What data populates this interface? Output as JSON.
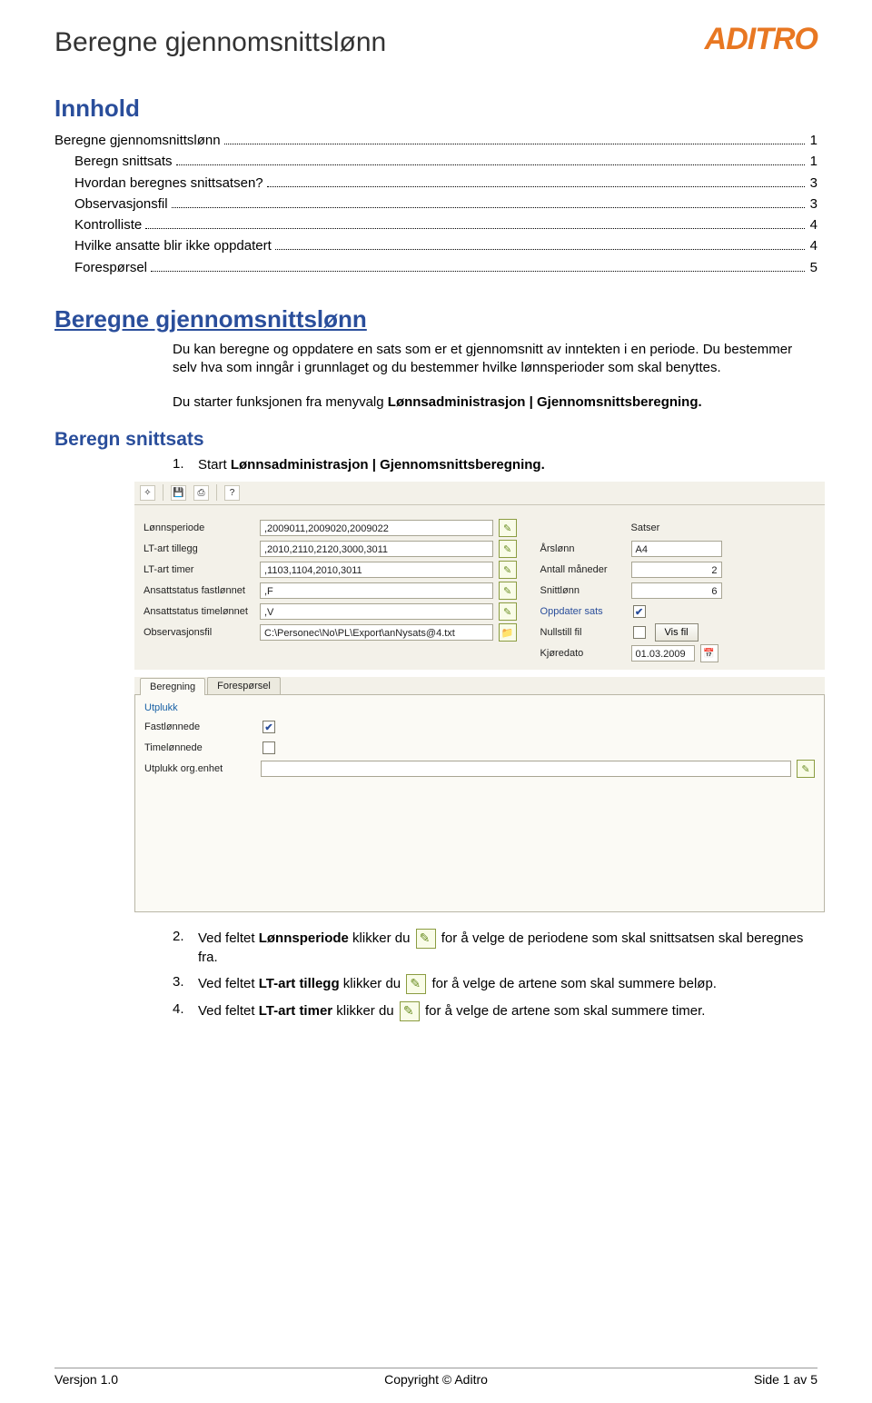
{
  "header": {
    "title": "Beregne gjennomsnittslønn",
    "logo": "ADITRO"
  },
  "toc": {
    "heading": "Innhold",
    "items": [
      {
        "label": "Beregne gjennomsnittslønn",
        "page": "1",
        "indent": false
      },
      {
        "label": "Beregn snittsats",
        "page": "1",
        "indent": true
      },
      {
        "label": "Hvordan beregnes snittsatsen?",
        "page": "3",
        "indent": true
      },
      {
        "label": "Observasjonsfil",
        "page": "3",
        "indent": true
      },
      {
        "label": "Kontrolliste",
        "page": "4",
        "indent": true
      },
      {
        "label": "Hvilke ansatte blir ikke oppdatert",
        "page": "4",
        "indent": true
      },
      {
        "label": "Forespørsel",
        "page": "5",
        "indent": true
      }
    ]
  },
  "main_heading": "Beregne gjennomsnittslønn",
  "para1": "Du kan beregne og oppdatere en sats som er et gjennomsnitt av inntekten i en periode. Du bestemmer selv hva som inngår i grunnlaget og du bestemmer hvilke lønnsperioder som skal benyttes.",
  "para2_a": "Du starter funksjonen fra menyvalg ",
  "para2_b": "Lønnsadministrasjon | Gjennomsnittsberegning.",
  "sub_heading": "Beregn snittsats",
  "step1_a": "Start ",
  "step1_b": "Lønnsadministrasjon | Gjennomsnittsberegning.",
  "step2_a": "Ved feltet ",
  "step2_b": "Lønnsperiode",
  "step2_c": " klikker du ",
  "step2_d": " for å velge de periodene som skal snittsatsen skal beregnes fra.",
  "step3_a": "Ved feltet ",
  "step3_b": "LT-art tillegg",
  "step3_c": " klikker du ",
  "step3_d": " for å velge de artene som skal summere beløp.",
  "step4_a": "Ved feltet ",
  "step4_b": "LT-art timer",
  "step4_c": " klikker du ",
  "step4_d": " for å velge de artene som skal summere timer.",
  "app": {
    "left": {
      "lonnsperiode": {
        "label": "Lønnsperiode",
        "value": ",2009011,2009020,2009022"
      },
      "lt_tillegg": {
        "label": "LT-art tillegg",
        "value": ",2010,2110,2120,3000,3011"
      },
      "lt_timer": {
        "label": "LT-art timer",
        "value": ",1103,1104,2010,3011"
      },
      "fastlonnet": {
        "label": "Ansattstatus fastlønnet",
        "value": ",F"
      },
      "timelonnet": {
        "label": "Ansattstatus timelønnet",
        "value": ",V"
      },
      "obsfil": {
        "label": "Observasjonsfil",
        "value": "C:\\Personec\\No\\PL\\Export\\anNysats@4.txt"
      }
    },
    "right": {
      "satser_label": "Satser",
      "arslonn": {
        "label": "Årslønn",
        "value": "A4"
      },
      "maneder": {
        "label": "Antall måneder",
        "value": "2"
      },
      "snittlonn": {
        "label": "Snittlønn",
        "value": "6"
      },
      "oppdater": {
        "label": "Oppdater sats",
        "checked": true
      },
      "nullstill": {
        "label": "Nullstill fil",
        "button": "Vis fil"
      },
      "kjoredato": {
        "label": "Kjøredato",
        "value": "01.03.2009"
      }
    },
    "tabs": {
      "beregning": "Beregning",
      "foresporsel": "Forespørsel"
    },
    "pane": {
      "group": "Utplukk",
      "fastlonnede": {
        "label": "Fastlønnede",
        "checked": true
      },
      "timelonnede": {
        "label": "Timelønnede",
        "checked": false
      },
      "orgenhet": {
        "label": "Utplukk org.enhet",
        "value": ""
      }
    }
  },
  "footer": {
    "left": "Versjon 1.0",
    "center": "Copyright © Aditro",
    "right": "Side 1 av 5"
  }
}
